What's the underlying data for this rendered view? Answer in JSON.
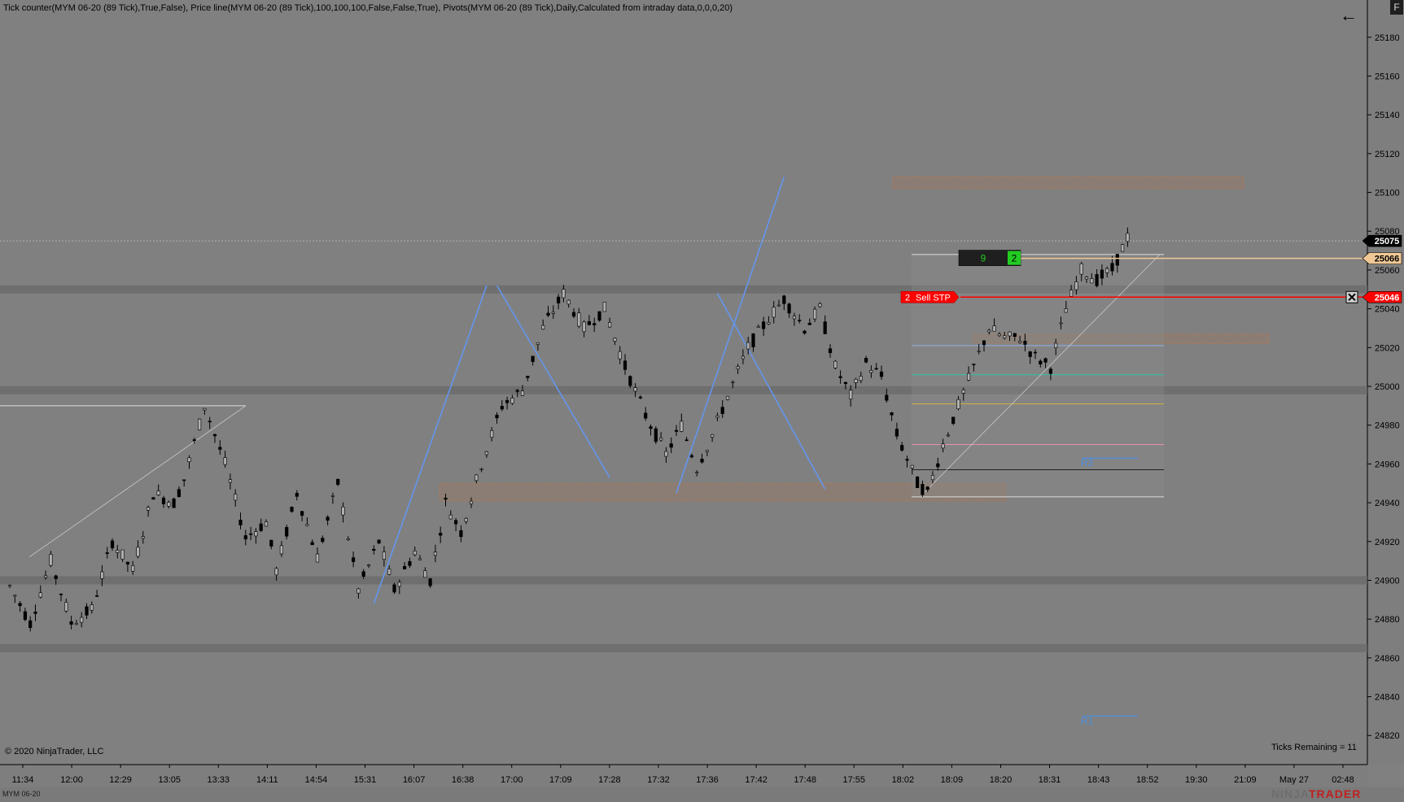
{
  "header": {
    "indicators_label": "Tick counter(MYM 06-20 (89 Tick),True,False), Price line(MYM 06-20 (89 Tick),100,100,100,False,False,True), Pivots(MYM 06-20 (89 Tick),Daily,Calculated from intraday data,0,0,0,20)",
    "back_icon": "arrow-left-icon",
    "f_button_label": "F"
  },
  "footer": {
    "copyright": "© 2020 NinjaTrader, LLC",
    "ticks_remaining": "Ticks Remaining = 11",
    "instrument_tab": "MYM 06-20",
    "brand_left": "NINJA",
    "brand_right": "TRADER"
  },
  "colors": {
    "background": "#808080",
    "axis_bg": "#7a7a7a",
    "candle": "#000000",
    "trendline": "#6495ed",
    "sell_order": "#ff0000",
    "last_price_marker": "#000000",
    "price_line_marker": "#f0c896",
    "tick_counter_bg": "#1f1f1f",
    "tick_counter_green": "#22cc22",
    "supply_zone": "#b87850"
  },
  "chart_data": {
    "type": "candlestick",
    "instrument": "MYM 06-20 (89 Tick)",
    "ylim": [
      24805,
      25195
    ],
    "y_ticks": [
      25180,
      25160,
      25140,
      25120,
      25100,
      25080,
      25060,
      25040,
      25020,
      25000,
      24980,
      24960,
      24940,
      24920,
      24900,
      24880,
      24860,
      24840,
      24820
    ],
    "x_tick_labels": [
      "11:34",
      "12:00",
      "12:29",
      "13:05",
      "13:33",
      "14:11",
      "14:54",
      "15:31",
      "16:07",
      "16:38",
      "17:00",
      "17:09",
      "17:28",
      "17:32",
      "17:36",
      "17:42",
      "17:48",
      "17:55",
      "18:02",
      "18:09",
      "18:20",
      "18:31",
      "18:43",
      "18:52",
      "19:30",
      "21:09",
      "May 27",
      "02:48"
    ],
    "price_path": [
      [
        0,
        24897
      ],
      [
        4,
        24878
      ],
      [
        8,
        24910
      ],
      [
        12,
        24878
      ],
      [
        16,
        24885
      ],
      [
        20,
        24920
      ],
      [
        24,
        24905
      ],
      [
        28,
        24945
      ],
      [
        32,
        24940
      ],
      [
        34,
        24952
      ],
      [
        38,
        24990
      ],
      [
        42,
        24960
      ],
      [
        46,
        24922
      ],
      [
        50,
        24930
      ],
      [
        52,
        24905
      ],
      [
        56,
        24945
      ],
      [
        60,
        24912
      ],
      [
        64,
        24950
      ],
      [
        68,
        24895
      ],
      [
        72,
        24920
      ],
      [
        75,
        24895
      ],
      [
        79,
        24915
      ],
      [
        82,
        24900
      ],
      [
        85,
        24940
      ],
      [
        88,
        24925
      ],
      [
        92,
        24960
      ],
      [
        96,
        24990
      ],
      [
        100,
        24998
      ],
      [
        104,
        25030
      ],
      [
        108,
        25048
      ],
      [
        112,
        25030
      ],
      [
        116,
        25040
      ],
      [
        120,
        25010
      ],
      [
        124,
        24985
      ],
      [
        128,
        24965
      ],
      [
        131,
        24980
      ],
      [
        134,
        24958
      ],
      [
        137,
        24975
      ],
      [
        140,
        24995
      ],
      [
        144,
        25020
      ],
      [
        148,
        25035
      ],
      [
        151,
        25045
      ],
      [
        155,
        25030
      ],
      [
        158,
        25040
      ],
      [
        161,
        25010
      ],
      [
        164,
        24995
      ],
      [
        167,
        25012
      ],
      [
        170,
        25005
      ],
      [
        173,
        24975
      ],
      [
        177,
        24950
      ],
      [
        179,
        24945
      ],
      [
        182,
        24970
      ],
      [
        185,
        24990
      ],
      [
        188,
        25010
      ],
      [
        191,
        25030
      ],
      [
        194,
        25025
      ],
      [
        197,
        25025
      ],
      [
        200,
        25015
      ],
      [
        203,
        25010
      ],
      [
        206,
        25040
      ],
      [
        209,
        25060
      ],
      [
        212,
        25055
      ],
      [
        215,
        25060
      ],
      [
        218,
        25077
      ]
    ],
    "pivot_levels": [
      {
        "name": "R2",
        "value": 24963
      },
      {
        "name": "R1",
        "value": 24830
      }
    ],
    "support_resistance_bands": [
      25050,
      24998,
      24900,
      24865
    ],
    "zones": [
      {
        "top": 25108,
        "bottom": 25102
      },
      {
        "top": 25027,
        "bottom": 25022
      },
      {
        "top": 24950,
        "bottom": 24941
      }
    ],
    "fib_levels": [
      25068,
      25021,
      25006,
      24991,
      24970,
      24957,
      24943
    ],
    "price_markers": {
      "last_price": "25075",
      "price_line": "25066",
      "sell_stop": "25046"
    },
    "order": {
      "quantity": "2",
      "label": "Sell STP"
    },
    "tick_counter": {
      "left_value": "9",
      "right_value": "2"
    }
  }
}
